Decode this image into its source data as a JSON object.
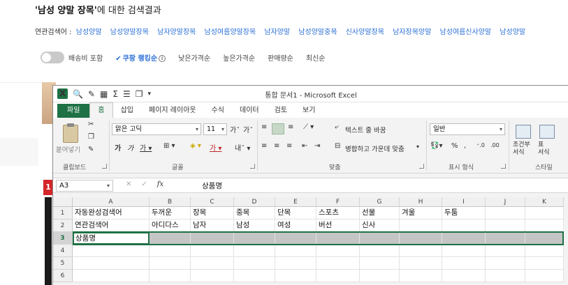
{
  "search": {
    "query_title": "'남성 양말 장목'",
    "title_suffix": "에 대한 검색결과",
    "related_label": "연관검색어 :",
    "related_keywords": [
      "남성양말",
      "남성양말장목",
      "남자양말장목",
      "남성여름양말장목",
      "남자양말",
      "남성양말중목",
      "신사양말장목",
      "남자장목양말",
      "남성여름신사양말",
      "남성양말"
    ],
    "shipping_toggle": "배송비 포함",
    "sort_options": [
      "쿠팡 랭킹순",
      "낮은가격순",
      "높은가격순",
      "판매량순",
      "최신순"
    ],
    "active_sort": "쿠팡 랭킹순",
    "badge_number": "1"
  },
  "excel": {
    "window_title": "통합 문서1 - Microsoft Excel",
    "tabs": [
      "파일",
      "홈",
      "삽입",
      "페이지 레이아웃",
      "수식",
      "데이터",
      "검토",
      "보기"
    ],
    "active_tab": "홈",
    "ribbon": {
      "paste_label": "붙여넣기",
      "font_name": "맑은 고딕",
      "font_size": "11",
      "number_format": "일반",
      "wrap_text": "텍스트 줄 바꿈",
      "merge_center": "병합하고 가운데 맞춤",
      "percent": "%",
      "comma": ",",
      "conditional_format": "조건부\n서식",
      "format_table": "표\n서식",
      "groups": [
        "클립보드",
        "글꼴",
        "맞춤",
        "표시 형식",
        "스타일"
      ]
    },
    "name_box": "A3",
    "formula_value": "상품명",
    "columns": [
      "A",
      "B",
      "C",
      "D",
      "E",
      "F",
      "G",
      "H",
      "I",
      "J",
      "K"
    ],
    "rows": [
      "1",
      "2",
      "3",
      "4",
      "5",
      "6"
    ],
    "cells": {
      "row1": [
        "자동완성검색어",
        "두꺼운",
        "장목",
        "중목",
        "단목",
        "스포츠",
        "선물",
        "겨울",
        "두툼",
        "",
        ""
      ],
      "row2": [
        "연관검색어",
        "아디다스",
        "남자",
        "남성",
        "여성",
        "버선",
        "신사",
        "",
        "",
        "",
        ""
      ],
      "row3": [
        "상품명",
        "",
        "",
        "",
        "",
        "",
        "",
        "",
        "",
        "",
        ""
      ]
    },
    "selected_row": "3",
    "accent_color": "#1e7145"
  }
}
